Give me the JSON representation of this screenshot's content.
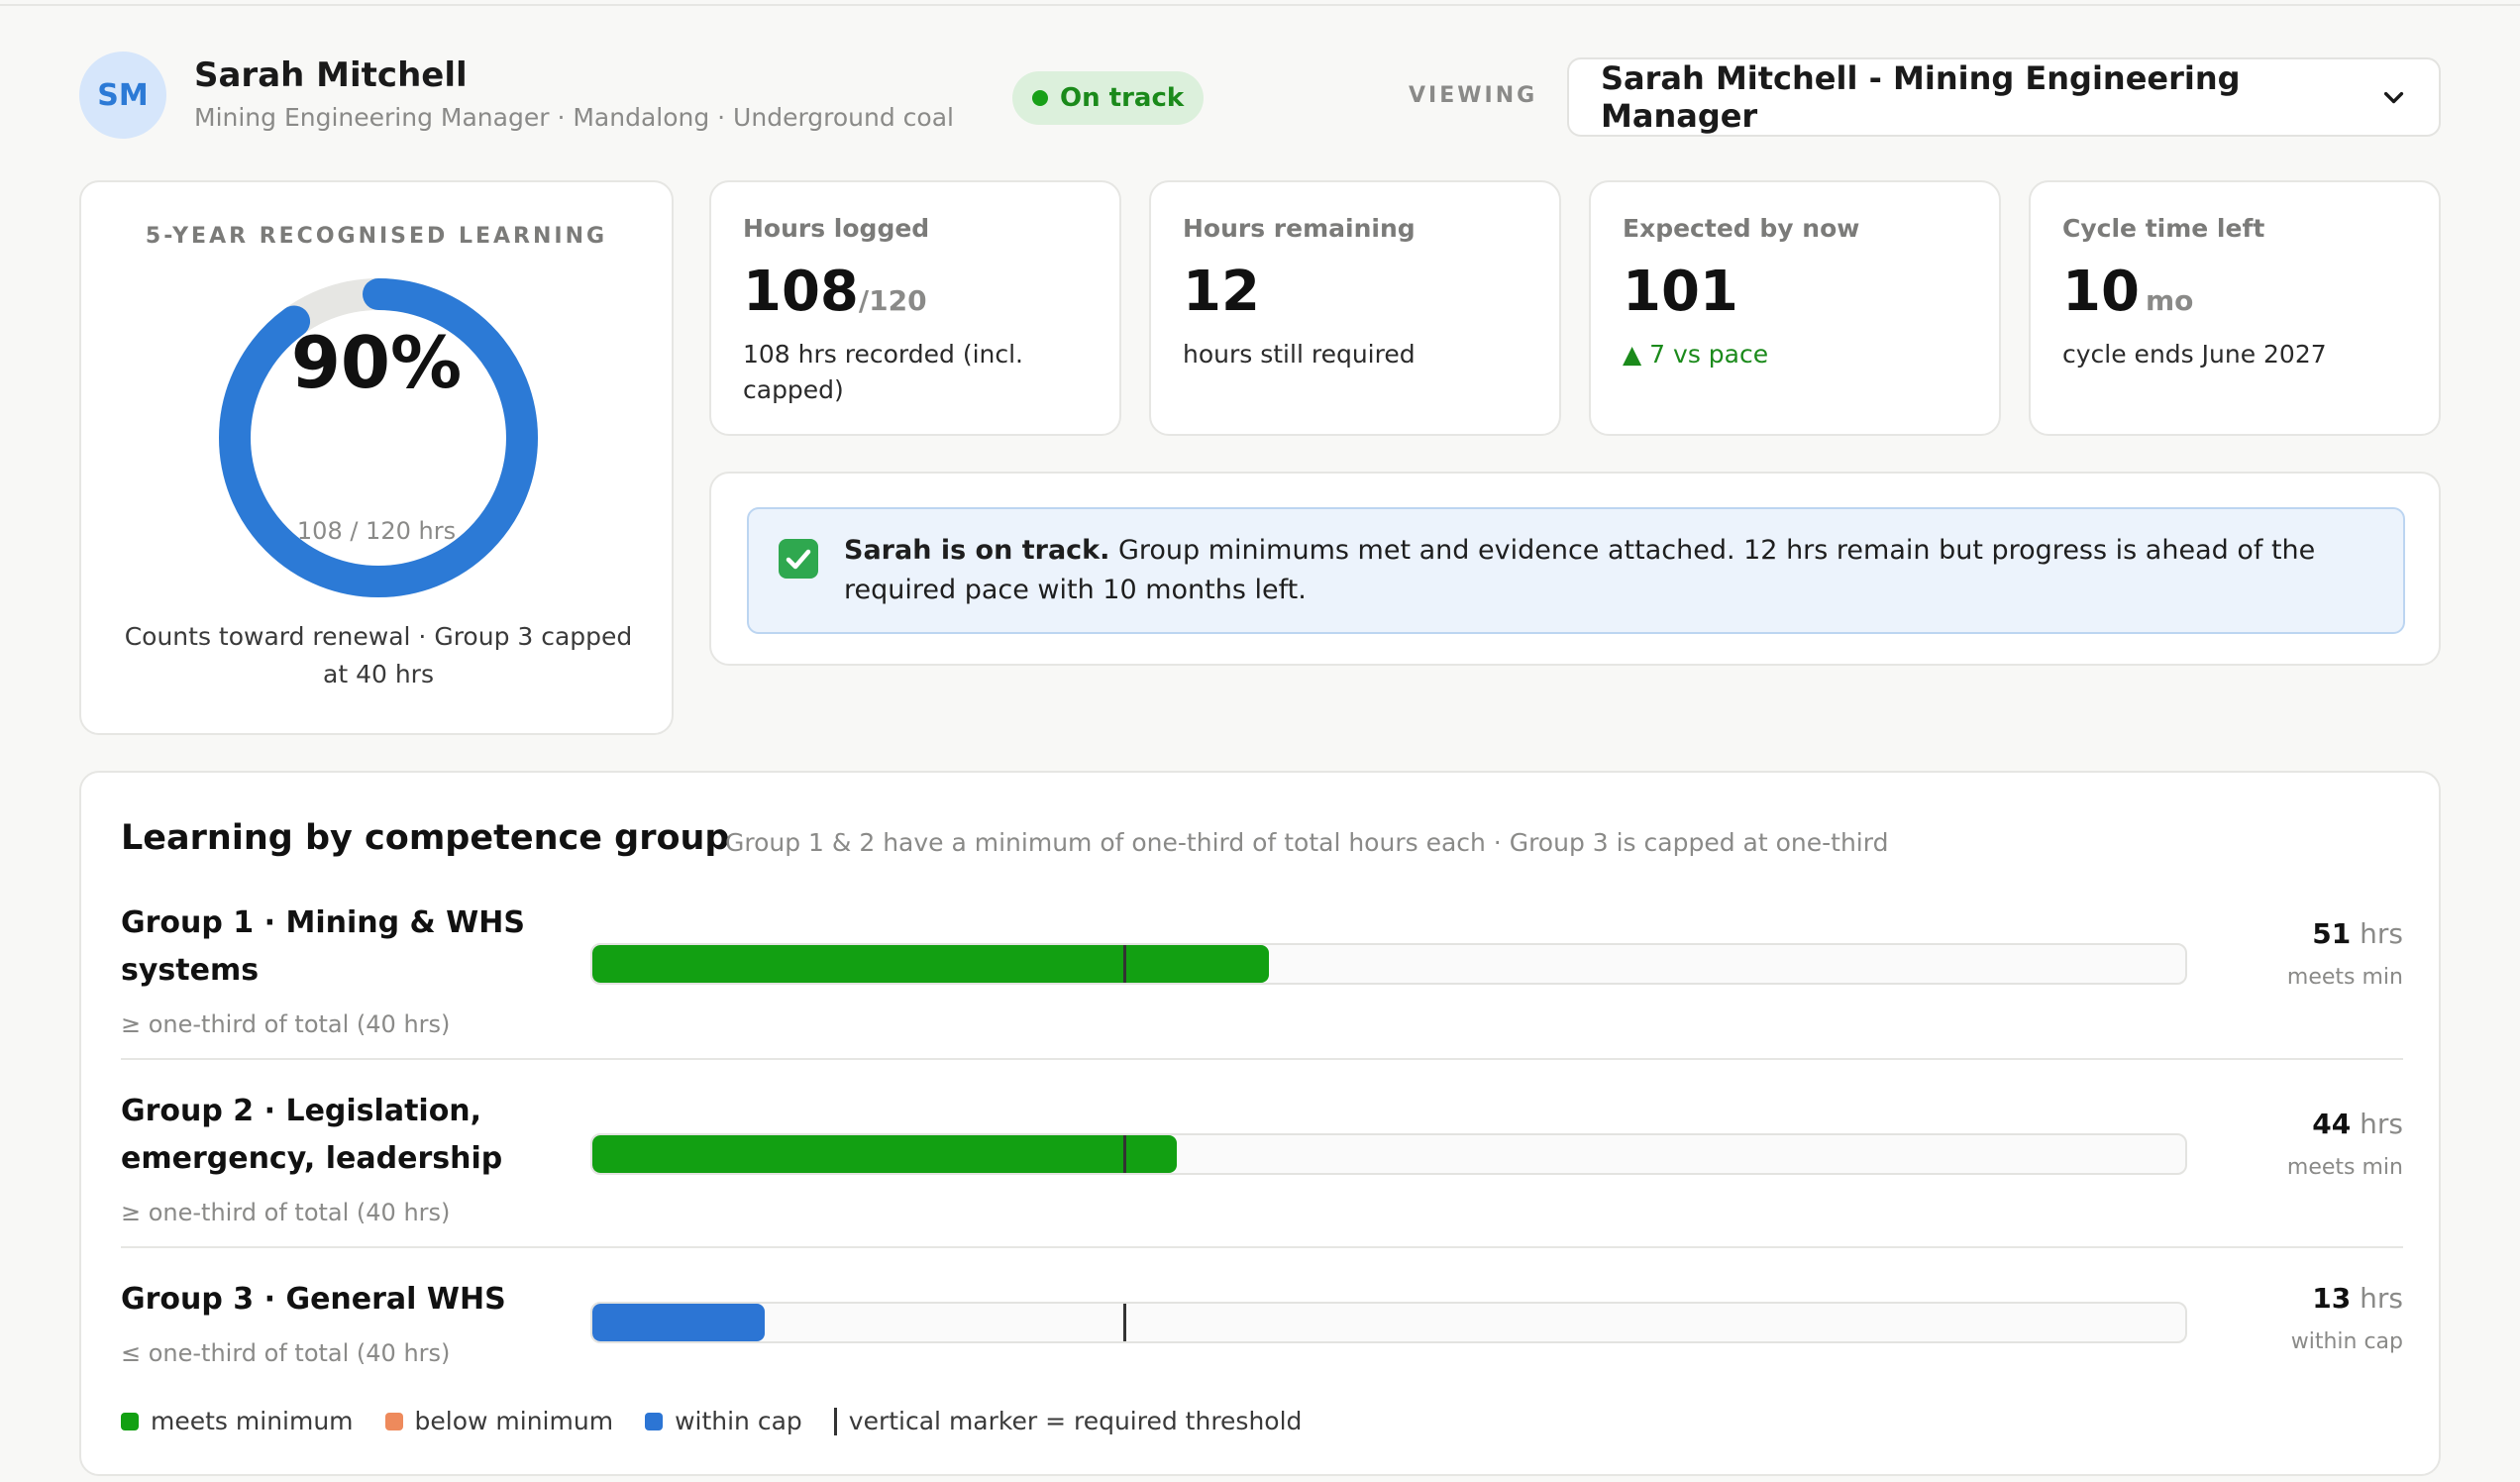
{
  "header": {
    "avatar_initials": "SM",
    "name": "Sarah Mitchell",
    "subtitle": "Mining Engineering Manager · Mandalong · Underground coal",
    "status": "On track",
    "viewing_label": "VIEWING",
    "viewing_value": "Sarah Mitchell - Mining Engineering Manager"
  },
  "summary": {
    "title": "5-YEAR RECOGNISED LEARNING",
    "percent": "90%",
    "percent_value": 90,
    "hours_text": "108 / 120 hrs",
    "note": "Counts toward renewal · Group 3 capped at 40 hrs"
  },
  "stats": [
    {
      "label": "Hours logged",
      "value": "108",
      "unit": "/120",
      "sub": "108 hrs recorded (incl. capped)"
    },
    {
      "label": "Hours remaining",
      "value": "12",
      "unit": "",
      "sub": "hours still required"
    },
    {
      "label": "Expected by now",
      "value": "101",
      "unit": "",
      "sub": "▲ 7 vs pace"
    },
    {
      "label": "Cycle time left",
      "value": "10",
      "unit": "mo",
      "sub": "cycle ends June 2027"
    }
  ],
  "alert": {
    "lead": "Sarah is on track.",
    "text": " Group minimums met and evidence attached. 12 hrs remain but progress is ahead of the required pace with 10 months left."
  },
  "groups": {
    "title": "Learning by competence group",
    "subtitle": "Group 1 & 2 have a minimum of one-third of total hours each · Group 3 is capped at one-third",
    "scale_max_hours": 120,
    "threshold_hours": 40,
    "items": [
      {
        "name": "Group 1 · Mining & WHS systems",
        "rule": "≥ one-third of total (40 hrs)",
        "hours": 51,
        "hours_num": "51",
        "hours_unit": "hrs",
        "state": "meets min",
        "color": "#12a012"
      },
      {
        "name": "Group 2 · Legislation, emergency, leadership",
        "rule": "≥ one-third of total (40 hrs)",
        "hours": 44,
        "hours_num": "44",
        "hours_unit": "hrs",
        "state": "meets min",
        "color": "#12a012"
      },
      {
        "name": "Group 3 · General WHS",
        "rule": "≤ one-third of total (40 hrs)",
        "hours": 13,
        "hours_num": "13",
        "hours_unit": "hrs",
        "state": "within cap",
        "color": "#2c75d4"
      }
    ]
  },
  "legend": {
    "meets": "meets minimum",
    "below": "below minimum",
    "cap": "within cap",
    "marker": "vertical marker = required threshold",
    "colors": {
      "meets": "#12a012",
      "below": "#ee8a5c",
      "cap": "#2c75d4"
    }
  }
}
